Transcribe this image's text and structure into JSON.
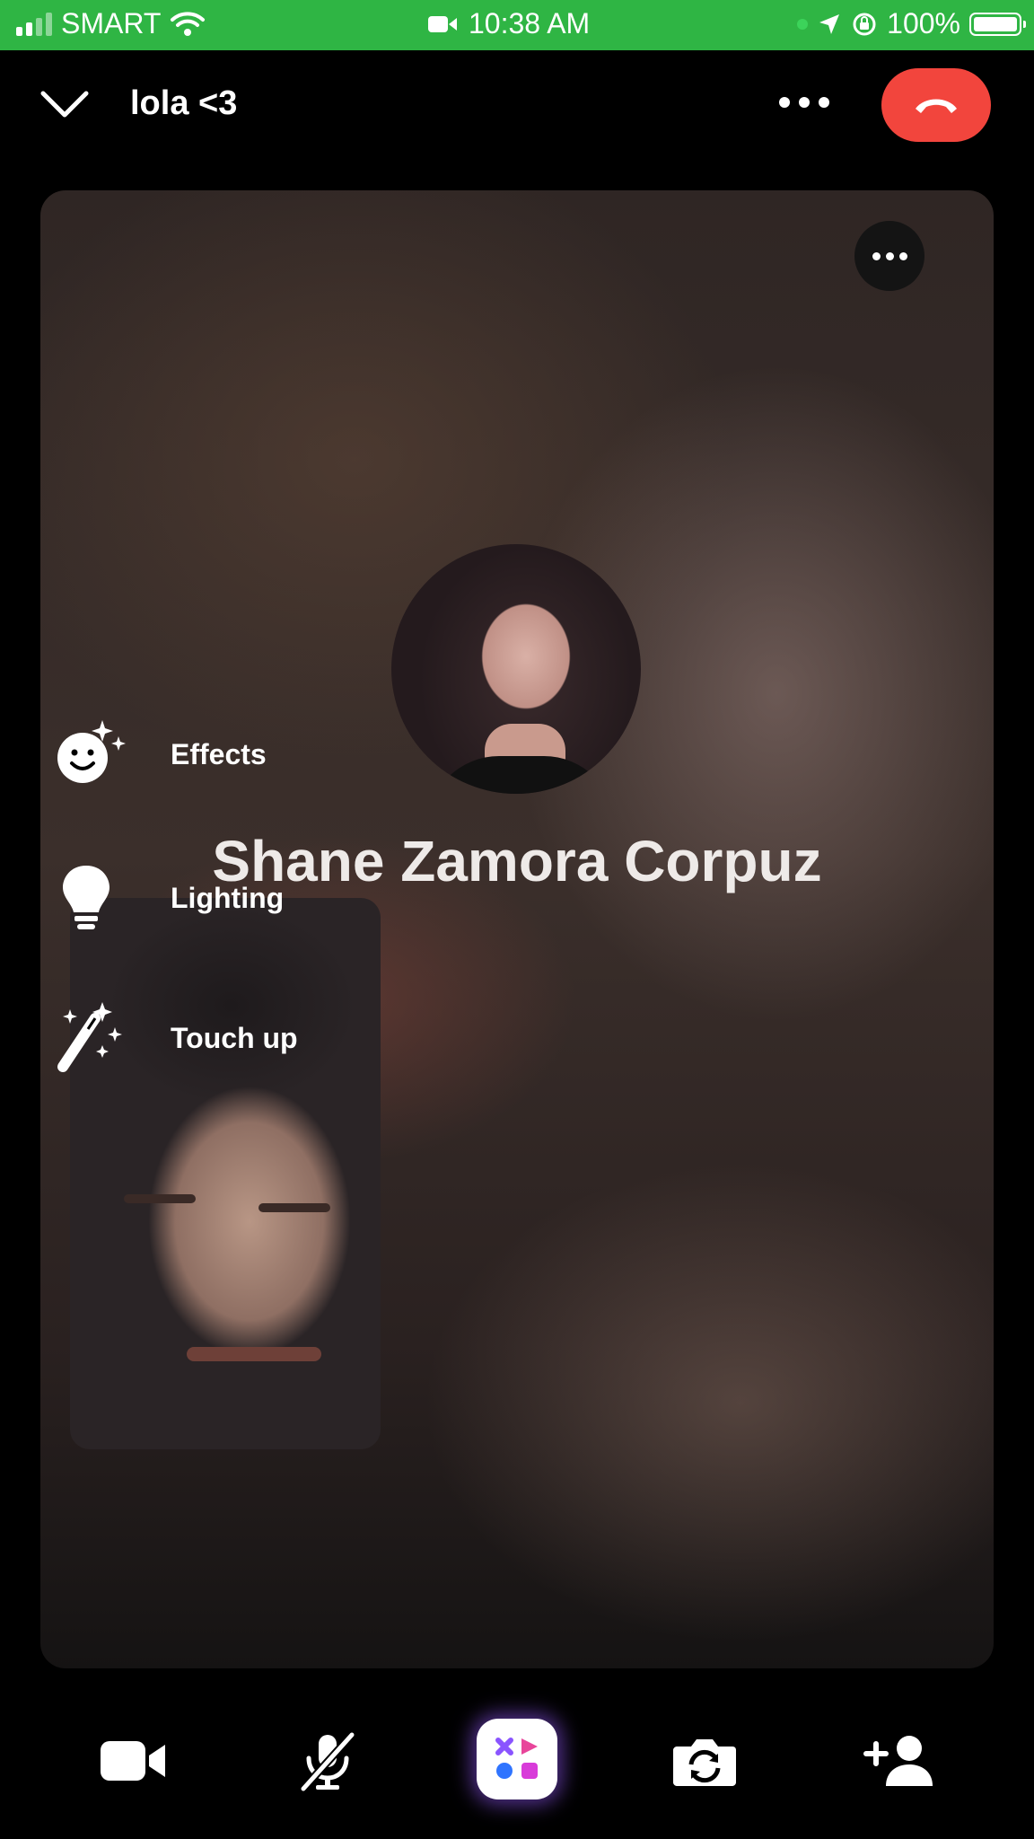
{
  "status_bar": {
    "carrier": "SMART",
    "time": "10:38 AM",
    "battery": "100%"
  },
  "header": {
    "title": "lola <3"
  },
  "call": {
    "caller_name": "Shane Zamora Corpuz"
  },
  "effects_menu": {
    "items": [
      {
        "label": "Effects",
        "icon": "effects-icon"
      },
      {
        "label": "Lighting",
        "icon": "lightbulb-icon"
      },
      {
        "label": "Touch up",
        "icon": "magic-wand-icon"
      }
    ]
  },
  "toolbar": {
    "items": [
      "video-camera-icon",
      "mic-muted-icon",
      "activities-icon",
      "flip-camera-icon",
      "add-person-icon"
    ]
  },
  "colors": {
    "status_bar": "#2fb544",
    "end_call": "#f2453d",
    "background": "#000000"
  }
}
